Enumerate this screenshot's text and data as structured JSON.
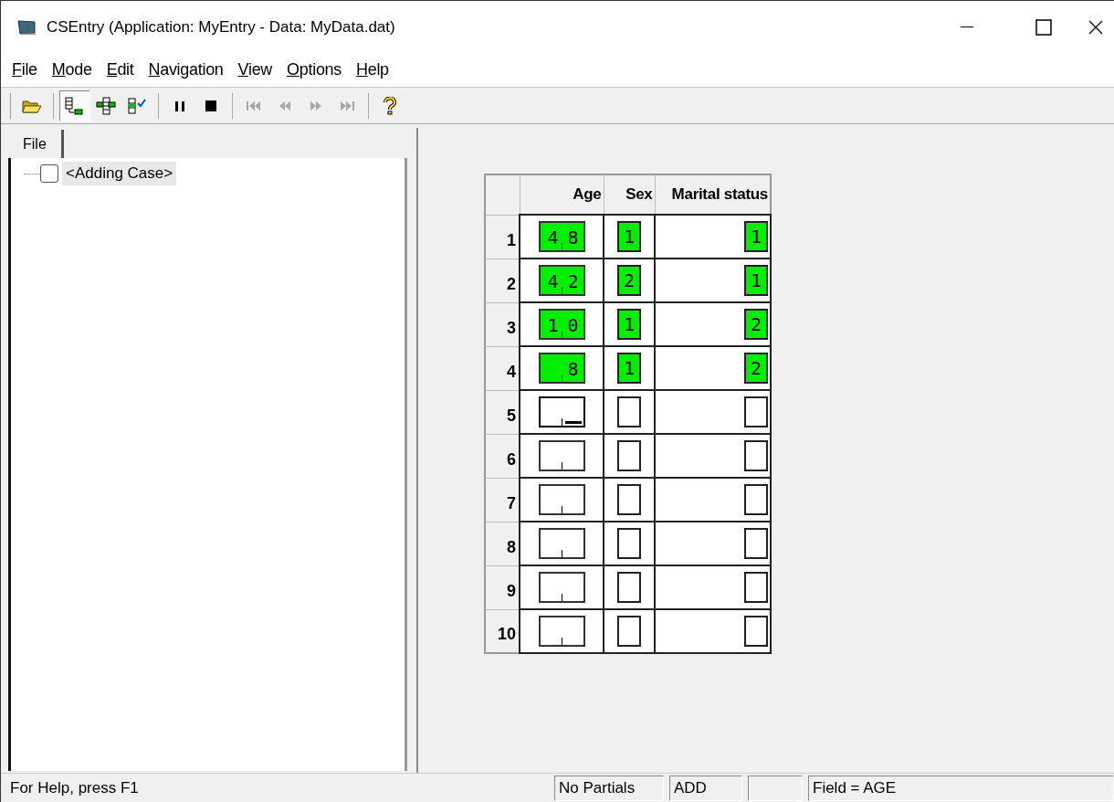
{
  "window": {
    "title": "CSEntry (Application: MyEntry - Data: MyData.dat)"
  },
  "menu": [
    {
      "label": "File"
    },
    {
      "label": "Mode"
    },
    {
      "label": "Edit"
    },
    {
      "label": "Navigation"
    },
    {
      "label": "View"
    },
    {
      "label": "Options"
    },
    {
      "label": "Help"
    }
  ],
  "toolbar": [
    {
      "kind": "open",
      "disabled": false,
      "pressed": false
    },
    {
      "kind": "sep"
    },
    {
      "kind": "add",
      "disabled": false,
      "pressed": true
    },
    {
      "kind": "insert",
      "disabled": false,
      "pressed": false
    },
    {
      "kind": "verify",
      "disabled": false,
      "pressed": false
    },
    {
      "kind": "sep"
    },
    {
      "kind": "pause",
      "disabled": false,
      "pressed": false
    },
    {
      "kind": "stop",
      "disabled": false,
      "pressed": false
    },
    {
      "kind": "sep"
    },
    {
      "kind": "first",
      "disabled": true,
      "pressed": false
    },
    {
      "kind": "prev",
      "disabled": true,
      "pressed": false
    },
    {
      "kind": "next",
      "disabled": true,
      "pressed": false
    },
    {
      "kind": "last",
      "disabled": true,
      "pressed": false
    },
    {
      "kind": "sep"
    },
    {
      "kind": "help",
      "disabled": false,
      "pressed": false
    }
  ],
  "sidebar": {
    "tab": {
      "label": "File",
      "selected": true
    },
    "tree": [
      {
        "label": "<Adding Case>",
        "checked": false,
        "selected": true
      }
    ]
  },
  "roster": {
    "columns": [
      "Age",
      "Sex",
      "Marital status"
    ],
    "rows": [
      {
        "number": "1",
        "age": "48",
        "sex": "1",
        "marital": "1",
        "current": false
      },
      {
        "number": "2",
        "age": "42",
        "sex": "2",
        "marital": "1",
        "current": false
      },
      {
        "number": "3",
        "age": "10",
        "sex": "1",
        "marital": "2",
        "current": false
      },
      {
        "number": "4",
        "age": "8",
        "sex": "1",
        "marital": "2",
        "current": false
      },
      {
        "number": "5",
        "current": true
      },
      {
        "number": "6",
        "current": false
      },
      {
        "number": "7",
        "current": false
      },
      {
        "number": "8",
        "current": false
      },
      {
        "number": "9",
        "current": false
      },
      {
        "number": "10",
        "current": false
      }
    ]
  },
  "status_bar": {
    "message": "For Help, press F1",
    "panes": [
      {
        "text": "No Partials"
      },
      {
        "text": "ADD"
      },
      {
        "text": "Field = AGE"
      }
    ]
  }
}
